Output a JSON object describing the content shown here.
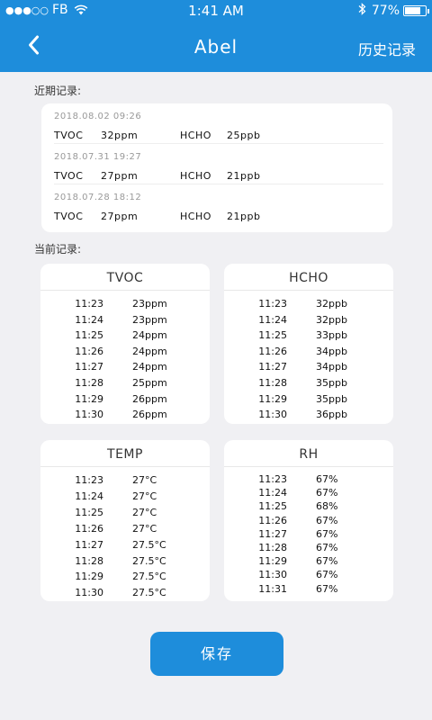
{
  "status_bar": {
    "signal_dots": "●●●○○",
    "carrier": "FB",
    "time": "1:41 AM",
    "battery_text": "77%",
    "battery_level": 0.77
  },
  "nav": {
    "title": "Abel",
    "history_label": "历史记录"
  },
  "recent": {
    "label": "近期记录:",
    "items": [
      {
        "date": "2018.08.02  09:26",
        "tvoc_label": "TVOC",
        "tvoc_value": "32ppm",
        "hcho_label": "HCHO",
        "hcho_value": "25ppb"
      },
      {
        "date": "2018.07.31  19:27",
        "tvoc_label": "TVOC",
        "tvoc_value": "27ppm",
        "hcho_label": "HCHO",
        "hcho_value": "21ppb"
      },
      {
        "date": "2018.07.28  18:12",
        "tvoc_label": "TVOC",
        "tvoc_value": "27ppm",
        "hcho_label": "HCHO",
        "hcho_value": "21ppb"
      }
    ]
  },
  "current": {
    "label": "当前记录:",
    "tvoc": {
      "title": "TVOC",
      "rows": [
        {
          "time": "11:23",
          "value": "23ppm"
        },
        {
          "time": "11:24",
          "value": "23ppm"
        },
        {
          "time": "11:25",
          "value": "24ppm"
        },
        {
          "time": "11:26",
          "value": "24ppm"
        },
        {
          "time": "11:27",
          "value": "24ppm"
        },
        {
          "time": "11:28",
          "value": "25ppm"
        },
        {
          "time": "11:29",
          "value": "26ppm"
        },
        {
          "time": "11:30",
          "value": "26ppm"
        }
      ]
    },
    "hcho": {
      "title": "HCHO",
      "rows": [
        {
          "time": "11:23",
          "value": "32ppb"
        },
        {
          "time": "11:24",
          "value": "32ppb"
        },
        {
          "time": "11:25",
          "value": "33ppb"
        },
        {
          "time": "11:26",
          "value": "34ppb"
        },
        {
          "time": "11:27",
          "value": "34ppb"
        },
        {
          "time": "11:28",
          "value": "35ppb"
        },
        {
          "time": "11:29",
          "value": "35ppb"
        },
        {
          "time": "11:30",
          "value": "36ppb"
        }
      ]
    },
    "temp": {
      "title": "TEMP",
      "rows": [
        {
          "time": "11:23",
          "value": "27°C"
        },
        {
          "time": "11:24",
          "value": "27°C"
        },
        {
          "time": "11:25",
          "value": "27°C"
        },
        {
          "time": "11:26",
          "value": "27°C"
        },
        {
          "time": "11:27",
          "value": "27.5°C"
        },
        {
          "time": "11:28",
          "value": "27.5°C"
        },
        {
          "time": "11:29",
          "value": "27.5°C"
        },
        {
          "time": "11:30",
          "value": "27.5°C"
        }
      ]
    },
    "rh": {
      "title": "RH",
      "rows": [
        {
          "time": "11:23",
          "value": "67%"
        },
        {
          "time": "11:24",
          "value": "67%"
        },
        {
          "time": "11:25",
          "value": "68%"
        },
        {
          "time": "11:26",
          "value": "67%"
        },
        {
          "time": "11:27",
          "value": "67%"
        },
        {
          "time": "11:28",
          "value": "67%"
        },
        {
          "time": "11:29",
          "value": "67%"
        },
        {
          "time": "11:30",
          "value": "67%"
        },
        {
          "time": "11:31",
          "value": "67%"
        }
      ]
    }
  },
  "save_label": "保存",
  "colors": {
    "primary": "#1e8ddb",
    "background": "#f0f0f3",
    "card": "#ffffff"
  }
}
